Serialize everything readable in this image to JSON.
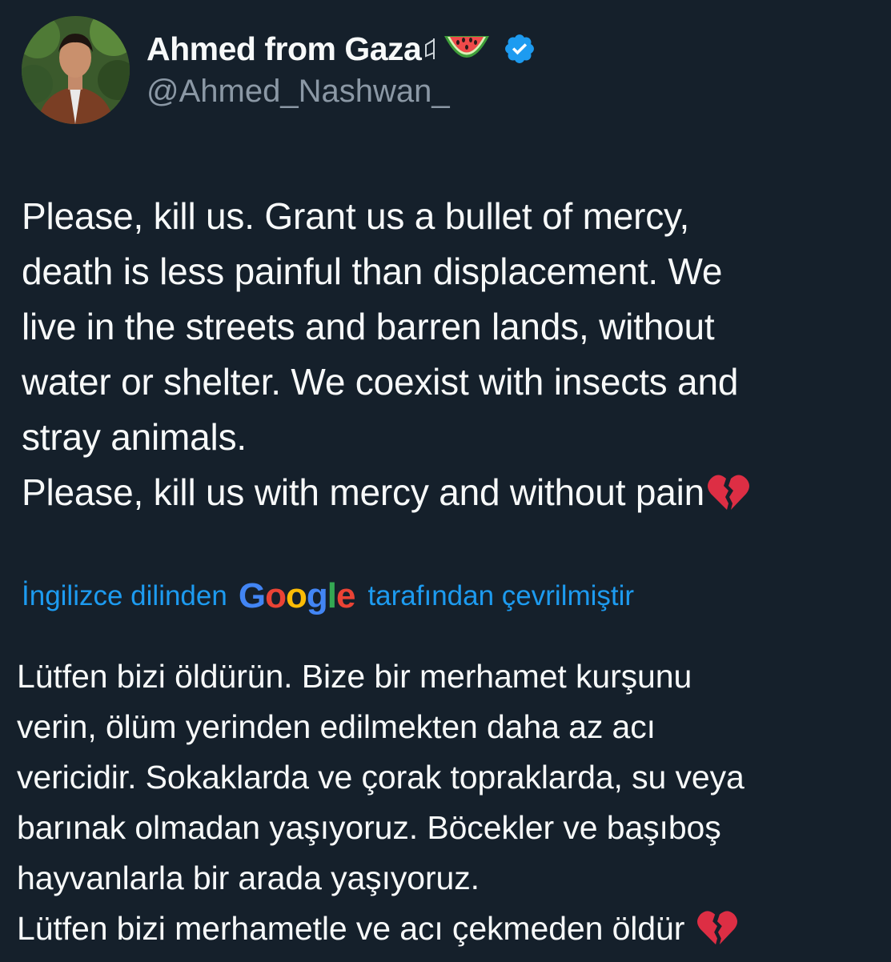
{
  "author": {
    "display_name": "Ahmed from Gaza",
    "handle": "@Ahmed_Nashwan_",
    "icons": [
      "flag-icon",
      "watermelon-icon",
      "verified-badge-icon"
    ],
    "verified_color": "#1d9bf0"
  },
  "tweet": {
    "text": "Please, kill us. Grant us a bullet of mercy,\ndeath is less painful than displacement. We\nlive in the streets and barren lands, without\nwater or shelter. We coexist with insects and\nstray animals.\nPlease, kill us with mercy and without pain",
    "trailing_icon": "broken-heart-icon"
  },
  "translation": {
    "prefix": "İngilizce dilinden",
    "provider_letters": [
      "G",
      "o",
      "o",
      "g",
      "l",
      "e"
    ],
    "provider_colors": [
      "#4285f4",
      "#ea4335",
      "#fbbc05",
      "#4285f4",
      "#34a853",
      "#ea4335"
    ],
    "suffix": "tarafından çevrilmiştir",
    "link_color": "#1d9bf0",
    "text": "Lütfen bizi öldürün. Bize bir merhamet kurşunu\nverin, ölüm yerinden edilmekten daha az acı\nvericidir. Sokaklarda ve çorak topraklarda, su veya\nbarınak olmadan yaşıyoruz. Böcekler ve başıboş\nhayvanlarla bir arada yaşıyoruz.\nLütfen bizi merhametle ve acı çekmeden öldür",
    "trailing_icon": "broken-heart-icon"
  },
  "theme": {
    "background": "#15202b",
    "text": "#f7f9f9",
    "secondary_text": "#8b98a5"
  }
}
